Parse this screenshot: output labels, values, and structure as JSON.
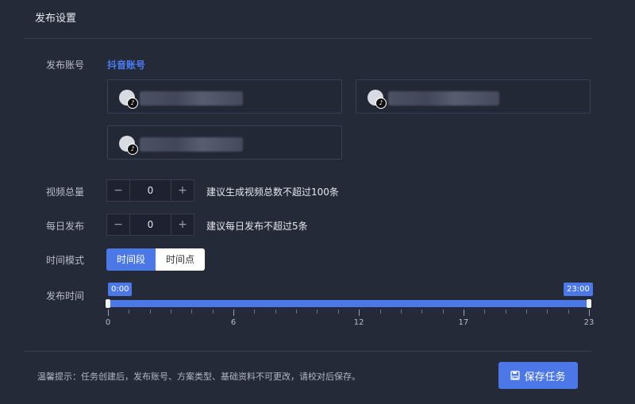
{
  "panel": {
    "title": "发布设置"
  },
  "account": {
    "label": "发布账号",
    "platform": "抖音账号",
    "cards": [
      {
        "name": ""
      },
      {
        "name": ""
      },
      {
        "name": ""
      }
    ]
  },
  "video_total": {
    "label": "视频总量",
    "value": "0",
    "minus": "−",
    "plus": "+",
    "hint": "建议生成视频总数不超过100条"
  },
  "daily_publish": {
    "label": "每日发布",
    "value": "0",
    "minus": "−",
    "plus": "+",
    "hint": "建议每日发布不超过5条"
  },
  "time_mode": {
    "label": "时间模式",
    "options": [
      "时间段",
      "时间点"
    ],
    "selected": "时间段"
  },
  "publish_time": {
    "label": "发布时间",
    "range": {
      "min": 0,
      "max": 23
    },
    "start_label": "0:00",
    "end_label": "23:00",
    "start_value": 0,
    "end_value": 23,
    "tick_labels": [
      "0",
      "6",
      "12",
      "17",
      "23"
    ],
    "tick_values": [
      0,
      6,
      12,
      17,
      23
    ]
  },
  "footer": {
    "note": "温馨提示：任务创建后，发布账号、方案类型、基础资料不可更改，请校对后保存。",
    "save_label": "保存任务",
    "save_icon": "save-icon"
  },
  "colors": {
    "accent": "#4b78e6",
    "link": "#4a7bf2",
    "background": "#252a38"
  }
}
